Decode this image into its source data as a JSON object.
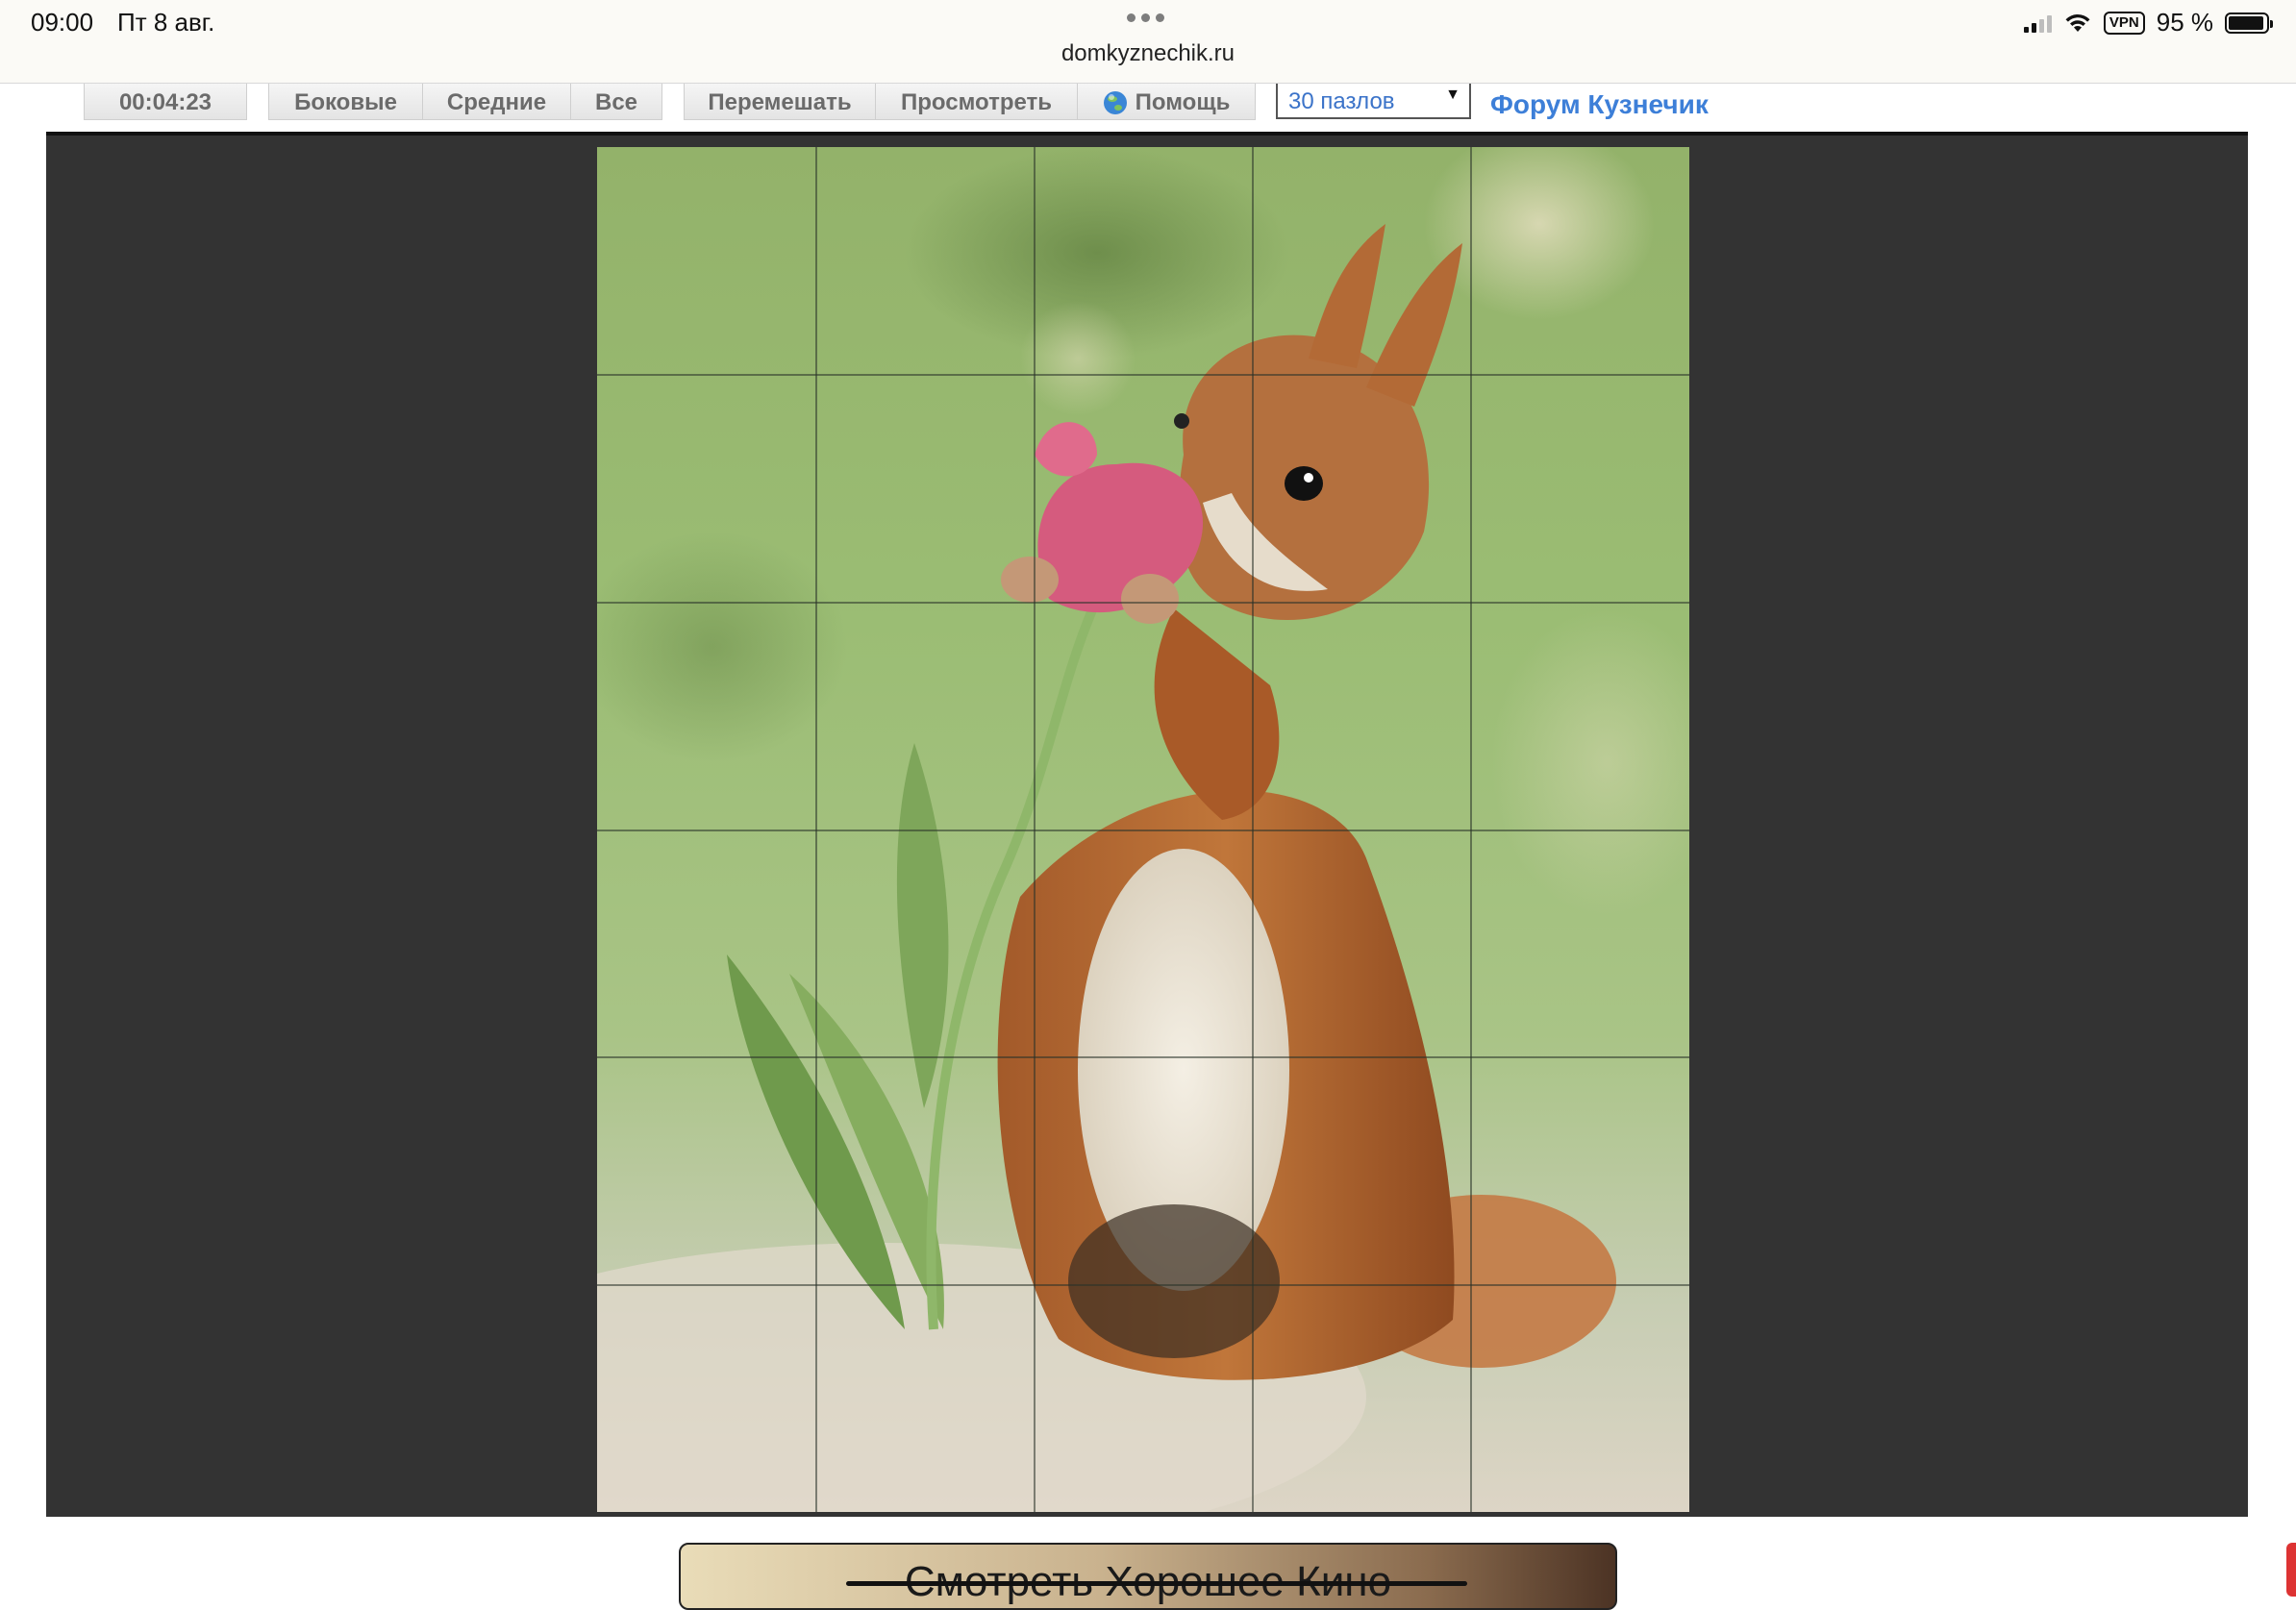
{
  "status_bar": {
    "time": "09:00",
    "date": "Пт 8 авг.",
    "url": "domkyznechik.ru",
    "vpn_label": "VPN",
    "battery": "95 %",
    "battery_level": 0.95
  },
  "toolbar": {
    "timer": "00:04:23",
    "edges_label": "Боковые",
    "middle_label": "Средние",
    "all_label": "Все",
    "shuffle_label": "Перемешать",
    "preview_label": "Просмотреть",
    "help_label": "Помощь",
    "pieces_select": "30 пазлов",
    "forum_link": "Форум Кузнечик"
  },
  "puzzle": {
    "columns": 5,
    "rows": 6,
    "image": "squirrel-smelling-tulip"
  },
  "ad": {
    "text": "Смотреть Хорошее Кино"
  },
  "colors": {
    "board_bg": "#333333",
    "link": "#3d7fd8",
    "toolbar_text": "#6b6b6b"
  }
}
